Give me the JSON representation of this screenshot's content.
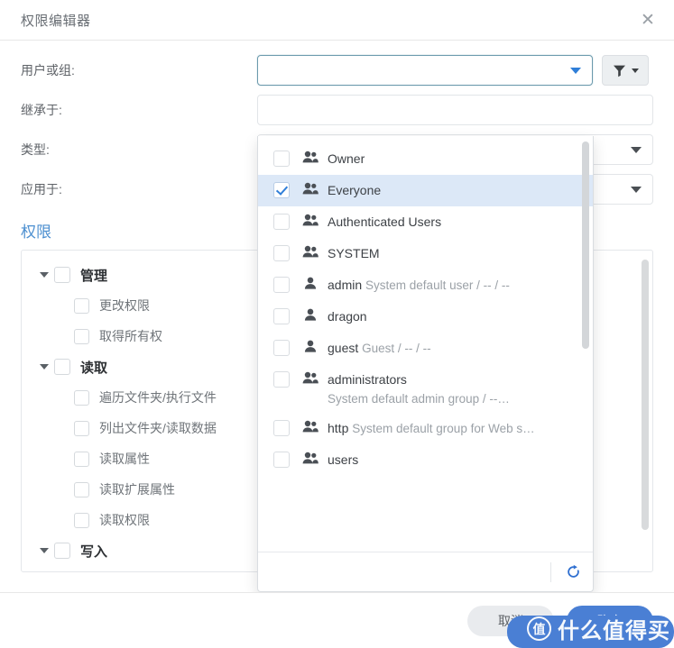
{
  "dialog": {
    "title": "权限编辑器",
    "close_icon": "close-icon"
  },
  "form": {
    "rows": [
      {
        "label": "用户或组:",
        "value": "",
        "type": "combobox"
      },
      {
        "label": "继承于:",
        "value": "",
        "type": "text"
      },
      {
        "label": "类型:",
        "value": "",
        "type": "select"
      },
      {
        "label": "应用于:",
        "value": "",
        "type": "select"
      }
    ],
    "filter_button": {
      "icon": "funnel-icon",
      "caret": "chevron-down-icon"
    }
  },
  "permissions": {
    "tab_label": "权限",
    "tree": [
      {
        "label": "管理",
        "level": "parent",
        "expanded": true,
        "checked": false
      },
      {
        "label": "更改权限",
        "level": "child",
        "checked": false
      },
      {
        "label": "取得所有权",
        "level": "child",
        "checked": false
      },
      {
        "label": "读取",
        "level": "parent",
        "expanded": true,
        "checked": false
      },
      {
        "label": "遍历文件夹/执行文件",
        "level": "child",
        "checked": false
      },
      {
        "label": "列出文件夹/读取数据",
        "level": "child",
        "checked": false
      },
      {
        "label": "读取属性",
        "level": "child",
        "checked": false
      },
      {
        "label": "读取扩展属性",
        "level": "child",
        "checked": false
      },
      {
        "label": "读取权限",
        "level": "child",
        "checked": false
      },
      {
        "label": "写入",
        "level": "parent",
        "expanded": true,
        "checked": false
      }
    ]
  },
  "dropdown": {
    "open": true,
    "items": [
      {
        "name": "Owner",
        "sub": "",
        "icon": "group-icon",
        "checked": false,
        "selected": false
      },
      {
        "name": "Everyone",
        "sub": "",
        "icon": "group-icon",
        "checked": true,
        "selected": true
      },
      {
        "name": "Authenticated Users",
        "sub": "",
        "icon": "group-icon",
        "checked": false,
        "selected": false
      },
      {
        "name": "SYSTEM",
        "sub": "",
        "icon": "group-icon",
        "checked": false,
        "selected": false
      },
      {
        "name": "admin",
        "sub": "System default user / -- / --",
        "icon": "user-icon",
        "checked": false,
        "selected": false
      },
      {
        "name": "dragon",
        "sub": "",
        "icon": "user-icon",
        "checked": false,
        "selected": false
      },
      {
        "name": "guest",
        "sub": "Guest / -- / --",
        "icon": "user-icon",
        "checked": false,
        "selected": false
      },
      {
        "name": "administrators",
        "sub": "System default admin group / --…",
        "icon": "group-icon",
        "checked": false,
        "selected": false
      },
      {
        "name": "http",
        "sub": "System default group for Web s…",
        "icon": "group-icon",
        "checked": false,
        "selected": false
      },
      {
        "name": "users",
        "sub": "",
        "icon": "group-icon",
        "checked": false,
        "selected": false
      }
    ],
    "search": {
      "value": "",
      "placeholder": ""
    },
    "refresh_icon": "refresh-icon"
  },
  "footer": {
    "cancel_label": "取消",
    "ok_label": "确定"
  },
  "watermark": {
    "badge": "值",
    "text": "什么值得买"
  },
  "colors": {
    "accent": "#4a7fd4",
    "link": "#4c8fd0",
    "selected_row": "#dce8f7",
    "check": "#2f7ed8",
    "filter_bg": "#eceff1"
  }
}
